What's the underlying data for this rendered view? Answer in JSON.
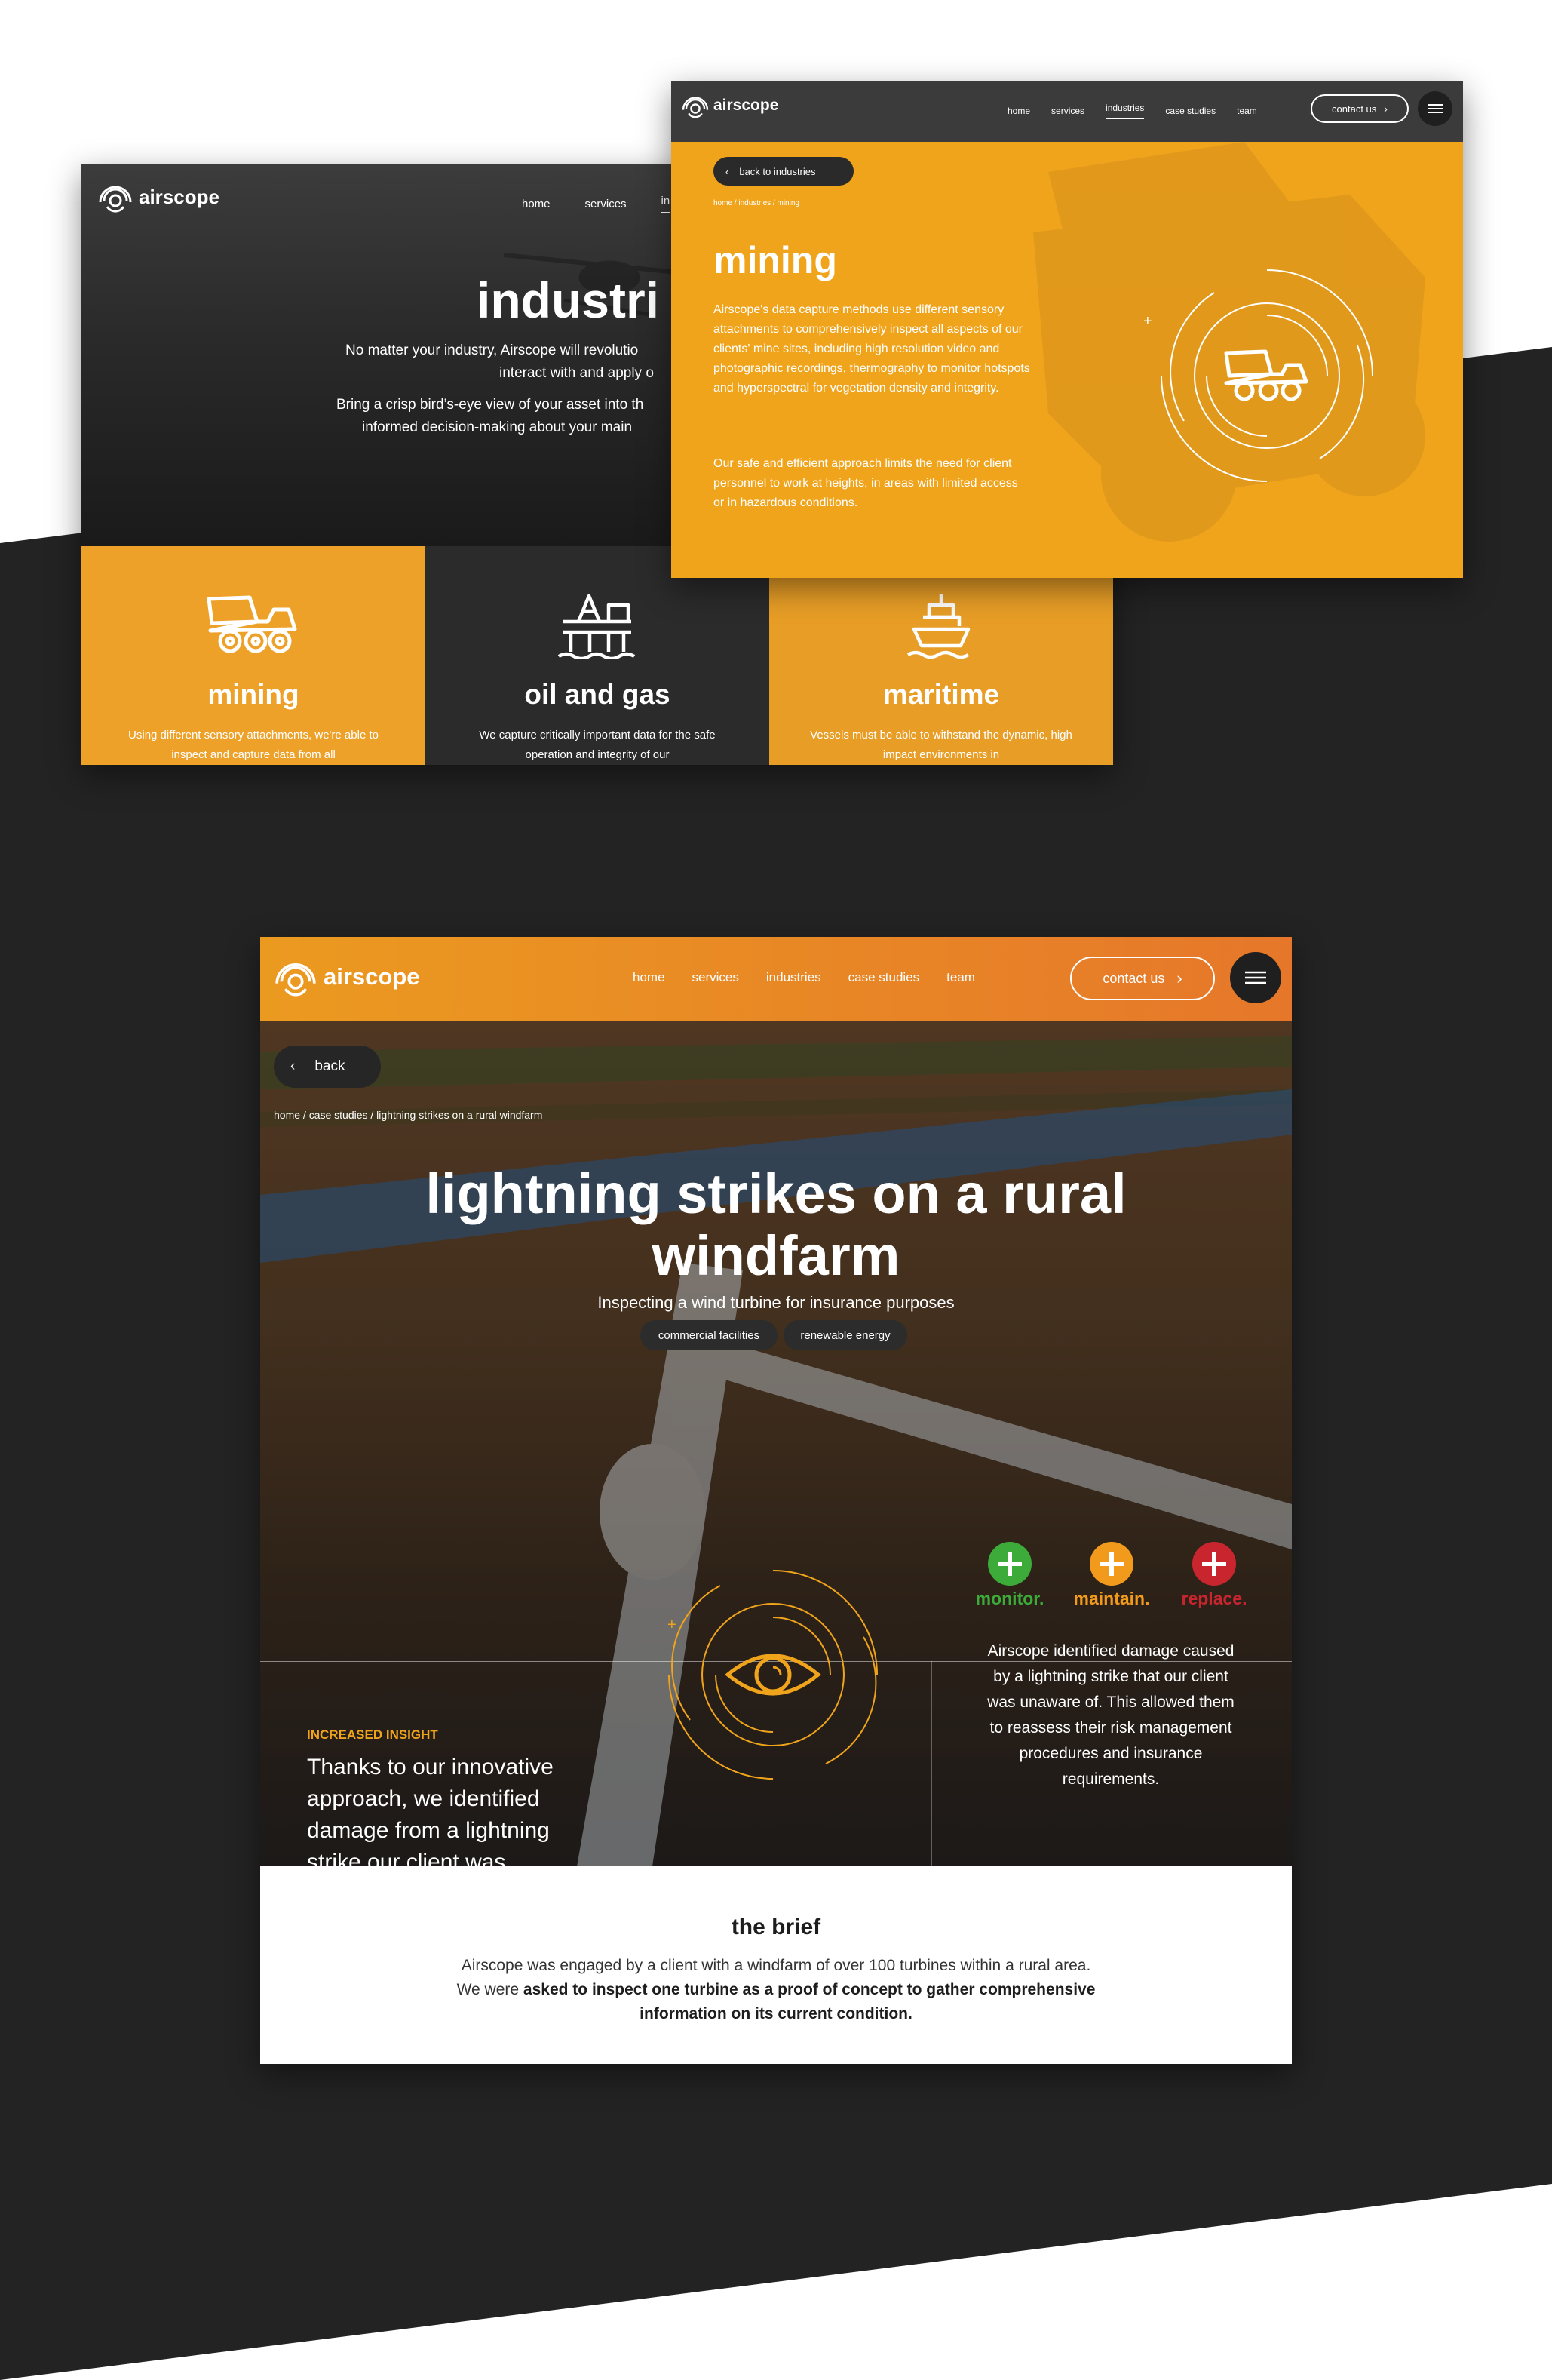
{
  "colors": {
    "dark": "#232323",
    "orange": "#f0a41c",
    "accent_orange": "#e6772a",
    "green": "#3cab3a",
    "mid_orange": "#f29a1c",
    "red": "#c8252f"
  },
  "brand": {
    "name": "airscope",
    "tm": "™"
  },
  "overview": {
    "nav": [
      "home",
      "services",
      "in"
    ],
    "title": "industri",
    "lead1_a": "No matter your industry, Airscope will revolutio",
    "lead1_b": "interact with and apply o",
    "lead2_a": "Bring a crisp bird’s-eye view of your asset into th",
    "lead2_b": "informed decision-making about your main",
    "tiles": [
      {
        "title": "mining",
        "desc": "Using different sensory attachments, we're able to inspect and capture data from all",
        "icon": "dump-truck-icon"
      },
      {
        "title": "oil and gas",
        "desc": "We capture critically important data for the safe operation and integrity of our",
        "icon": "oil-rig-icon"
      },
      {
        "title": "maritime",
        "desc": "Vessels must be able to withstand the dynamic, high impact environments in",
        "icon": "ship-icon"
      }
    ]
  },
  "mining": {
    "nav": [
      "home",
      "services",
      "industries",
      "case studies",
      "team"
    ],
    "active": "industries",
    "contact": "contact us",
    "back": "back to industries",
    "breadcrumb": "home / industries / mining",
    "title": "mining",
    "p1": "Airscope's data capture methods use different sensory attachments to comprehensively inspect all aspects of our clients' mine sites, including high resolution video and photographic recordings, thermography to monitor hotspots and hyperspectral for vegetation density and integrity.",
    "p2": "Our safe and efficient approach limits the need for client personnel to work at heights, in areas with limited access or in hazardous conditions."
  },
  "case": {
    "nav": [
      "home",
      "services",
      "industries",
      "case studies",
      "team"
    ],
    "contact": "contact us",
    "back": "back",
    "breadcrumb": "home / case studies / lightning strikes on a rural windfarm",
    "title_l1": "lightning strikes on a rural",
    "title_l2": "windfarm",
    "subtitle": "Inspecting a wind turbine for insurance purposes",
    "tags": [
      "commercial facilities",
      "renewable energy"
    ],
    "insight_label": "INCREASED INSIGHT",
    "insight_text": "Thanks to our innovative approach, we identified damage from a lightning strike our client was unaware of.",
    "actions": [
      "monitor.",
      "maintain.",
      "replace."
    ],
    "result": "Airscope identified damage caused by a lightning strike that our client was unaware of. This allowed them to reassess their risk management procedures and insurance requirements.",
    "brief_title": "the brief",
    "brief_plain": "Airscope was engaged by a client with a windfarm of over 100 turbines within a rural area. We were ",
    "brief_bold": "asked to inspect one turbine as a proof of concept to gather comprehensive information on its current condition."
  }
}
